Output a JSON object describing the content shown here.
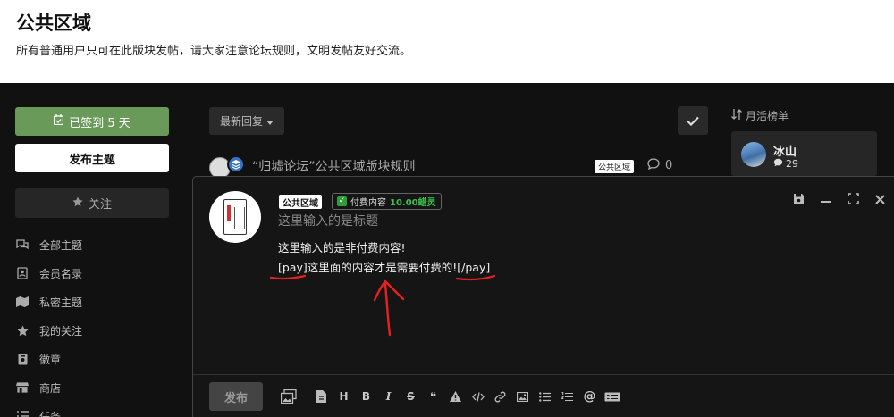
{
  "hero": {
    "title": "公共区域",
    "description": "所有普通用户只可在此版块发帖，请大家注意论坛规则，文明发帖友好交流。"
  },
  "sidebar": {
    "checkin_label": "已签到 5 天",
    "post_label": "发布主题",
    "follow_label": "关注",
    "nav": [
      {
        "label": "全部主题",
        "icon": "comments-icon"
      },
      {
        "label": "会员名录",
        "icon": "address-book-icon"
      },
      {
        "label": "私密主题",
        "icon": "map-icon"
      },
      {
        "label": "我的关注",
        "icon": "star-icon"
      },
      {
        "label": "徽章",
        "icon": "badge-icon"
      },
      {
        "label": "商店",
        "icon": "store-icon"
      },
      {
        "label": "任务",
        "icon": "list-icon"
      }
    ]
  },
  "list": {
    "sort_label": "最新回复",
    "thread": {
      "title": "“归墟论坛”公共区域版块规则",
      "tag": "公共区域",
      "replies": "0"
    }
  },
  "rank": {
    "heading": "月活榜单",
    "user": {
      "name": "冰山",
      "count": "29"
    }
  },
  "composer": {
    "tag": "公共区域",
    "pay_label": "付费内容",
    "pay_amount": "10.00蜡灵",
    "title_placeholder": "这里输入的是标题",
    "body_line1": "这里输入的是非付费内容!",
    "body_line2_open": "[pay]",
    "body_line2_mid": "这里面的内容才是需要付费的!",
    "body_line2_close": "[/pay]",
    "submit_label": "发布",
    "format_letters": {
      "heading": "H",
      "bold": "B",
      "italic": "I",
      "strike": "S",
      "quote": "❝"
    }
  },
  "colors": {
    "checkin_green": "#6a9a5a",
    "pay_green": "#3ec14b",
    "annotation_red": "#e8201f"
  }
}
